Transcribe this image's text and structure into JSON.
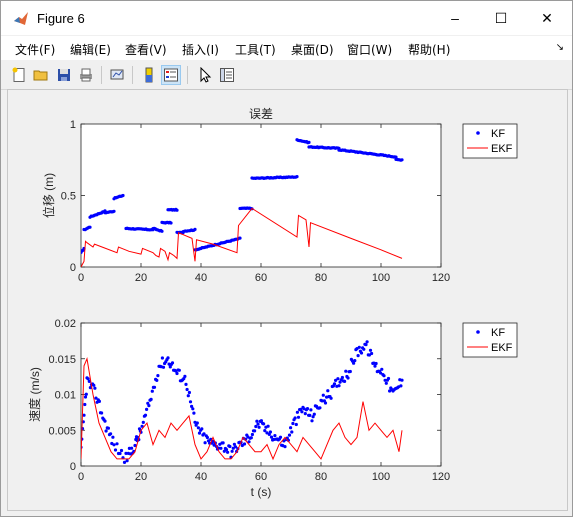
{
  "window": {
    "title": "Figure 6",
    "minimize": "–",
    "maximize": "☐",
    "close": "✕"
  },
  "menu": {
    "items": [
      "文件(F)",
      "编辑(E)",
      "查看(V)",
      "插入(I)",
      "工具(T)",
      "桌面(D)",
      "窗口(W)",
      "帮助(H)"
    ],
    "overflow": "↘"
  },
  "toolbar": {
    "icons": [
      "new-figure-icon",
      "open-file-icon",
      "save-icon",
      "print-icon",
      "link-plot-icon",
      "insert-colorbar-icon",
      "insert-legend-icon",
      "pointer-icon",
      "property-inspector-icon"
    ]
  },
  "colors": {
    "kf": "#0000ff",
    "ekf": "#ff0000",
    "axes_bg": "#ffffff",
    "figure_bg": "#f0f0f0"
  },
  "chart_data": [
    {
      "type": "scatter",
      "title": "误差",
      "xlabel": "",
      "ylabel": "位移 (m)",
      "xlim": [
        0,
        120
      ],
      "ylim": [
        0,
        1
      ],
      "xticks": [
        0,
        20,
        40,
        60,
        80,
        100,
        120
      ],
      "yticks": [
        0,
        0.5,
        1
      ],
      "ytick_labels": [
        "0",
        "0.5",
        "1"
      ],
      "legend": {
        "position": "outside-right-top",
        "entries": [
          "KF",
          "EKF"
        ]
      },
      "series": [
        {
          "name": "KF",
          "style": "dots",
          "color": "#0000ff",
          "segments": [
            {
              "x": [
                0,
                1
              ],
              "y": [
                0.1,
                0.13
              ]
            },
            {
              "x": [
                1,
                3
              ],
              "y": [
                0.26,
                0.28
              ]
            },
            {
              "x": [
                3,
                8
              ],
              "y": [
                0.35,
                0.39
              ]
            },
            {
              "x": [
                8,
                11
              ],
              "y": [
                0.38,
                0.39
              ]
            },
            {
              "x": [
                11,
                14
              ],
              "y": [
                0.48,
                0.5
              ]
            },
            {
              "x": [
                15,
                24
              ],
              "y": [
                0.27,
                0.26
              ]
            },
            {
              "x": [
                24,
                27
              ],
              "y": [
                0.27,
                0.25
              ]
            },
            {
              "x": [
                27,
                30
              ],
              "y": [
                0.31,
                0.31
              ]
            },
            {
              "x": [
                29,
                32
              ],
              "y": [
                0.4,
                0.4
              ]
            },
            {
              "x": [
                32,
                34
              ],
              "y": [
                0.24,
                0.24
              ]
            },
            {
              "x": [
                34,
                38
              ],
              "y": [
                0.25,
                0.26
              ]
            },
            {
              "x": [
                38,
                53
              ],
              "y": [
                0.12,
                0.2
              ]
            },
            {
              "x": [
                53,
                57
              ],
              "y": [
                0.41,
                0.41
              ]
            },
            {
              "x": [
                57,
                72
              ],
              "y": [
                0.62,
                0.63
              ]
            },
            {
              "x": [
                72,
                76
              ],
              "y": [
                0.89,
                0.87
              ]
            },
            {
              "x": [
                76,
                86
              ],
              "y": [
                0.84,
                0.83
              ]
            },
            {
              "x": [
                86,
                105
              ],
              "y": [
                0.82,
                0.77
              ]
            },
            {
              "x": [
                105,
                107
              ],
              "y": [
                0.75,
                0.75
              ]
            }
          ]
        },
        {
          "name": "EKF",
          "style": "line",
          "color": "#ff0000",
          "x": [
            0,
            1,
            1.5,
            2,
            4,
            4.5,
            7,
            12,
            12.5,
            16,
            20,
            20.5,
            24,
            25,
            26,
            26.5,
            28,
            29,
            29.5,
            31,
            32,
            32.5,
            37,
            38,
            38.5,
            44,
            52,
            52.5,
            57,
            72,
            72.5,
            75,
            76,
            76.5,
            90,
            100,
            107
          ],
          "y": [
            0.0,
            0.04,
            0.18,
            0.17,
            0.14,
            0.16,
            0.14,
            0.1,
            0.14,
            0.11,
            0.09,
            0.13,
            0.1,
            0.08,
            0.07,
            0.13,
            0.11,
            0.05,
            0.1,
            0.08,
            0.06,
            0.24,
            0.2,
            0.04,
            0.19,
            0.16,
            0.1,
            0.29,
            0.41,
            0.21,
            0.36,
            0.33,
            0.14,
            0.31,
            0.2,
            0.12,
            0.06
          ]
        }
      ]
    },
    {
      "type": "scatter",
      "title": "",
      "xlabel": "t (s)",
      "ylabel": "速度 (m/s)",
      "xlim": [
        0,
        120
      ],
      "ylim": [
        0,
        0.02
      ],
      "xticks": [
        0,
        20,
        40,
        60,
        80,
        100,
        120
      ],
      "yticks": [
        0,
        0.005,
        0.01,
        0.015,
        0.02
      ],
      "ytick_labels": [
        "0",
        "0.005",
        "0.01",
        "0.015",
        "0.02"
      ],
      "legend": {
        "position": "outside-right-top",
        "entries": [
          "KF",
          "EKF"
        ]
      },
      "series": [
        {
          "name": "KF",
          "style": "dots",
          "color": "#0000ff",
          "x": [
            0,
            2,
            5,
            8,
            11,
            15,
            18,
            20,
            23,
            26,
            29,
            32,
            35,
            38,
            41,
            44,
            47,
            50,
            53,
            56,
            59,
            62,
            65,
            68,
            71,
            74,
            77,
            80,
            83,
            86,
            89,
            92,
            95,
            98,
            101,
            104,
            107
          ],
          "y": [
            0.002,
            0.012,
            0.01,
            0.006,
            0.003,
            0.001,
            0.003,
            0.005,
            0.009,
            0.014,
            0.015,
            0.013,
            0.012,
            0.006,
            0.004,
            0.003,
            0.003,
            0.002,
            0.003,
            0.004,
            0.006,
            0.005,
            0.004,
            0.003,
            0.006,
            0.008,
            0.007,
            0.009,
            0.01,
            0.012,
            0.013,
            0.016,
            0.017,
            0.014,
            0.013,
            0.01,
            0.012
          ]
        },
        {
          "name": "EKF",
          "style": "line",
          "color": "#ff0000",
          "x": [
            0,
            1,
            2,
            4,
            6,
            8,
            10,
            12,
            14,
            16,
            18,
            20,
            22,
            24,
            26,
            28,
            30,
            32,
            34,
            36,
            38,
            40,
            42,
            44,
            46,
            48,
            50,
            52,
            54,
            56,
            58,
            60,
            62,
            64,
            66,
            68,
            70,
            72,
            74,
            76,
            78,
            80,
            82,
            84,
            86,
            88,
            90,
            92,
            94,
            96,
            98,
            100,
            102,
            104,
            106,
            107
          ],
          "y": [
            0.001,
            0.014,
            0.015,
            0.01,
            0.006,
            0.004,
            0.002,
            0.001,
            0.001,
            0.001,
            0.002,
            0.005,
            0.006,
            0.003,
            0.005,
            0.004,
            0.006,
            0.005,
            0.006,
            0.007,
            0.003,
            0.001,
            0.002,
            0.004,
            0.002,
            0.001,
            0.001,
            0.002,
            0.004,
            0.003,
            0.002,
            0.002,
            0.003,
            0.001,
            0.003,
            0.004,
            0.003,
            0.002,
            0.004,
            0.003,
            0.002,
            0.001,
            0.003,
            0.005,
            0.006,
            0.004,
            0.003,
            0.004,
            0.009,
            0.005,
            0.006,
            0.005,
            0.004,
            0.005,
            0.002,
            0.005
          ]
        }
      ]
    }
  ]
}
